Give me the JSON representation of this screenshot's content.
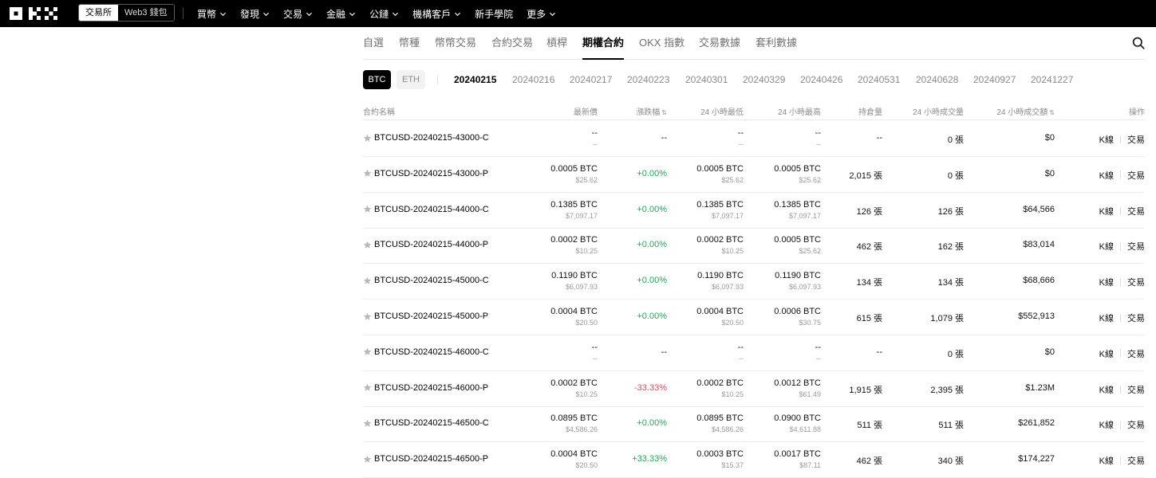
{
  "header": {
    "logo_text": "OKX",
    "switch": [
      {
        "label": "交易所",
        "active": true
      },
      {
        "label": "Web3 錢包",
        "active": false
      }
    ],
    "nav": [
      {
        "label": "買幣",
        "dropdown": true
      },
      {
        "label": "發現",
        "dropdown": true
      },
      {
        "label": "交易",
        "dropdown": true
      },
      {
        "label": "金融",
        "dropdown": true
      },
      {
        "label": "公鏈",
        "dropdown": true
      },
      {
        "label": "機構客戶",
        "dropdown": true
      },
      {
        "label": "新手學院",
        "dropdown": false
      },
      {
        "label": "更多",
        "dropdown": true
      }
    ]
  },
  "tabs": [
    {
      "label": "自選",
      "active": false
    },
    {
      "label": "幣種",
      "active": false
    },
    {
      "label": "幣幣交易",
      "active": false
    },
    {
      "label": "合約交易",
      "active": false
    },
    {
      "label": "槓桿",
      "active": false
    },
    {
      "label": "期權合約",
      "active": true
    },
    {
      "label": "OKX 指數",
      "active": false
    },
    {
      "label": "交易數據",
      "active": false
    },
    {
      "label": "套利數據",
      "active": false
    }
  ],
  "search_icon": "search-icon",
  "underlyings": [
    {
      "label": "BTC",
      "active": true
    },
    {
      "label": "ETH",
      "active": false
    }
  ],
  "dates": [
    {
      "label": "20240215",
      "active": true
    },
    {
      "label": "20240216",
      "active": false
    },
    {
      "label": "20240217",
      "active": false
    },
    {
      "label": "20240223",
      "active": false
    },
    {
      "label": "20240301",
      "active": false
    },
    {
      "label": "20240329",
      "active": false
    },
    {
      "label": "20240426",
      "active": false
    },
    {
      "label": "20240531",
      "active": false
    },
    {
      "label": "20240628",
      "active": false
    },
    {
      "label": "20240927",
      "active": false
    },
    {
      "label": "20241227",
      "active": false
    }
  ],
  "table": {
    "headers": {
      "name": "合約名稱",
      "last": "最新價",
      "change": "漲跌幅",
      "low": "24 小時最低",
      "high": "24 小時最高",
      "open_interest": "持倉量",
      "volume": "24 小時成交量",
      "amount": "24 小時成交額",
      "actions": "操作"
    },
    "action_labels": {
      "kline": "K線",
      "trade": "交易"
    },
    "rows": [
      {
        "name": "BTCUSD-20240215-43000-C",
        "last": "--",
        "last_usd": "--",
        "change": "--",
        "change_dir": "flat",
        "low": "--",
        "low_usd": "--",
        "high": "--",
        "high_usd": "--",
        "oi": "--",
        "volume": "0 張",
        "amount": "$0"
      },
      {
        "name": "BTCUSD-20240215-43000-P",
        "last": "0.0005 BTC",
        "last_usd": "$25.62",
        "change": "+0.00%",
        "change_dir": "up",
        "low": "0.0005 BTC",
        "low_usd": "$25.62",
        "high": "0.0005 BTC",
        "high_usd": "$25.62",
        "oi": "2,015 張",
        "volume": "0 張",
        "amount": "$0"
      },
      {
        "name": "BTCUSD-20240215-44000-C",
        "last": "0.1385 BTC",
        "last_usd": "$7,097.17",
        "change": "+0.00%",
        "change_dir": "up",
        "low": "0.1385 BTC",
        "low_usd": "$7,097.17",
        "high": "0.1385 BTC",
        "high_usd": "$7,097.17",
        "oi": "126 張",
        "volume": "126 張",
        "amount": "$64,566"
      },
      {
        "name": "BTCUSD-20240215-44000-P",
        "last": "0.0002 BTC",
        "last_usd": "$10.25",
        "change": "+0.00%",
        "change_dir": "up",
        "low": "0.0002 BTC",
        "low_usd": "$10.25",
        "high": "0.0005 BTC",
        "high_usd": "$25.62",
        "oi": "462 張",
        "volume": "162 張",
        "amount": "$83,014"
      },
      {
        "name": "BTCUSD-20240215-45000-C",
        "last": "0.1190 BTC",
        "last_usd": "$6,097.93",
        "change": "+0.00%",
        "change_dir": "up",
        "low": "0.1190 BTC",
        "low_usd": "$6,097.93",
        "high": "0.1190 BTC",
        "high_usd": "$6,097.93",
        "oi": "134 張",
        "volume": "134 張",
        "amount": "$68,666"
      },
      {
        "name": "BTCUSD-20240215-45000-P",
        "last": "0.0004 BTC",
        "last_usd": "$20.50",
        "change": "+0.00%",
        "change_dir": "up",
        "low": "0.0004 BTC",
        "low_usd": "$20.50",
        "high": "0.0006 BTC",
        "high_usd": "$30.75",
        "oi": "615 張",
        "volume": "1,079 張",
        "amount": "$552,913"
      },
      {
        "name": "BTCUSD-20240215-46000-C",
        "last": "--",
        "last_usd": "--",
        "change": "--",
        "change_dir": "flat",
        "low": "--",
        "low_usd": "--",
        "high": "--",
        "high_usd": "--",
        "oi": "--",
        "volume": "0 張",
        "amount": "$0"
      },
      {
        "name": "BTCUSD-20240215-46000-P",
        "last": "0.0002 BTC",
        "last_usd": "$10.25",
        "change": "-33.33%",
        "change_dir": "down",
        "low": "0.0002 BTC",
        "low_usd": "$10.25",
        "high": "0.0012 BTC",
        "high_usd": "$61.49",
        "oi": "1,915 張",
        "volume": "2,395 張",
        "amount": "$1.23M"
      },
      {
        "name": "BTCUSD-20240215-46500-C",
        "last": "0.0895 BTC",
        "last_usd": "$4,586.26",
        "change": "+0.00%",
        "change_dir": "up",
        "low": "0.0895 BTC",
        "low_usd": "$4,586.26",
        "high": "0.0900 BTC",
        "high_usd": "$4,611.88",
        "oi": "511 張",
        "volume": "511 張",
        "amount": "$261,852"
      },
      {
        "name": "BTCUSD-20240215-46500-P",
        "last": "0.0004 BTC",
        "last_usd": "$20.50",
        "change": "+33.33%",
        "change_dir": "up",
        "low": "0.0003 BTC",
        "low_usd": "$15.37",
        "high": "0.0017 BTC",
        "high_usd": "$87.11",
        "oi": "462 張",
        "volume": "340 張",
        "amount": "$174,227"
      }
    ]
  },
  "colors": {
    "up": "#1fa65a",
    "down": "#e0475d",
    "accent": "#000000"
  }
}
